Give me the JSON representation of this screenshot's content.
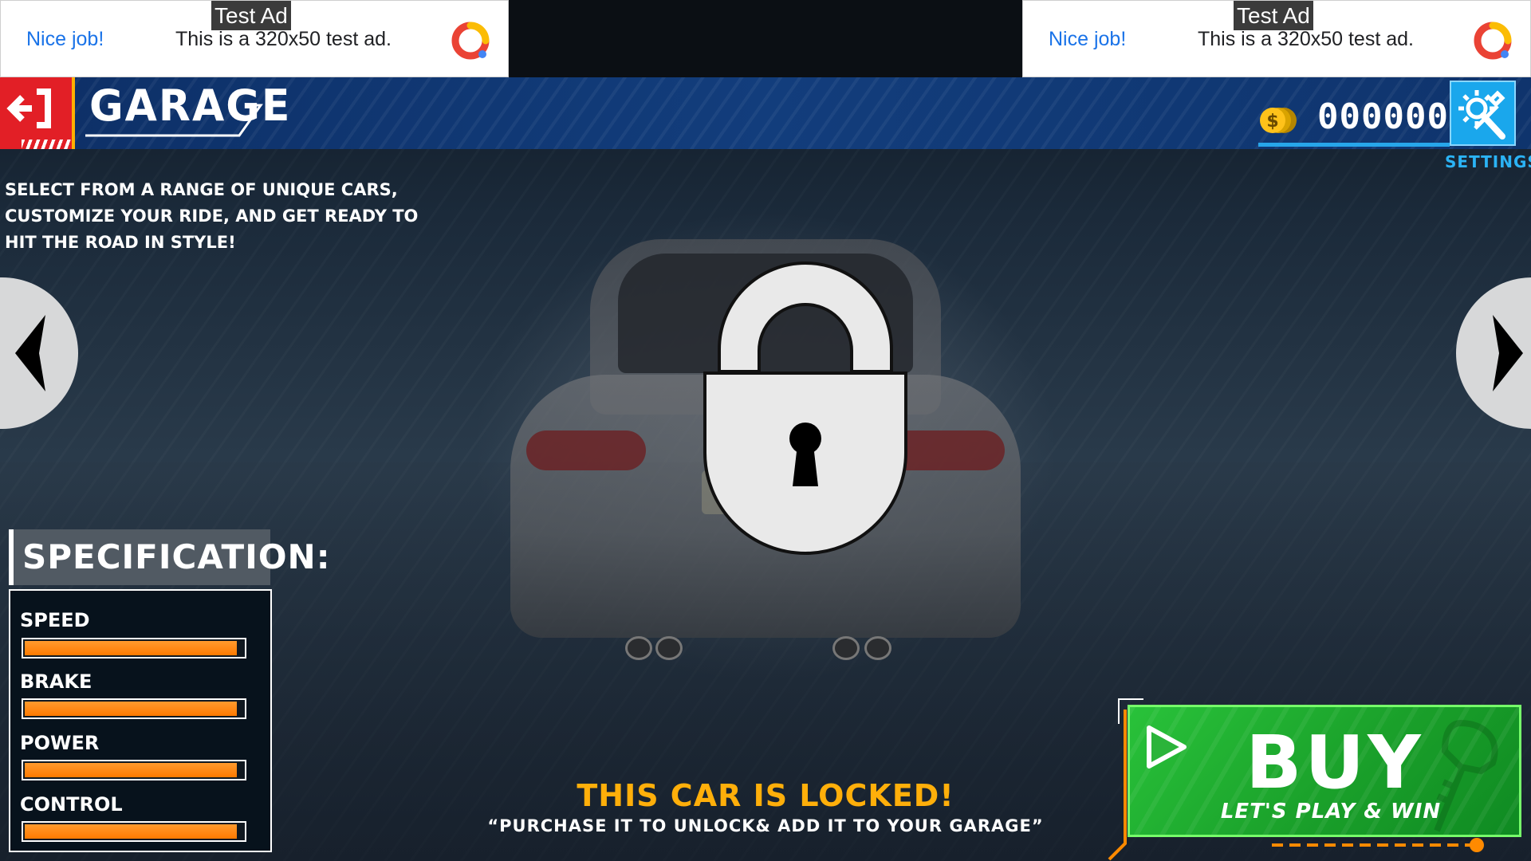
{
  "ads": [
    {
      "tag": "Test Ad",
      "headline": "Nice job!",
      "text": "This is a 320x50 test ad."
    },
    {
      "tag": "Test Ad",
      "headline": "Nice job!",
      "text": "This is a 320x50 test ad."
    }
  ],
  "header": {
    "title": "GARAGE",
    "coins": "000000",
    "settings_label": "SETTINGS",
    "exit_icon": "exit-icon",
    "settings_icon": "gear-wrench-icon",
    "coin_icon": "coin-icon"
  },
  "description": "SELECT FROM A RANGE OF UNIQUE CARS, CUSTOMIZE YOUR RIDE, AND GET READY TO HIT THE ROAD IN STYLE!",
  "navigation": {
    "prev_icon": "chevron-left-icon",
    "next_icon": "chevron-right-icon"
  },
  "lock_icon": "padlock-icon",
  "specification": {
    "title": "SPECIFICATION:",
    "stats": [
      {
        "label": "SPEED",
        "value": 0.97
      },
      {
        "label": "BRAKE",
        "value": 0.97
      },
      {
        "label": "POWER",
        "value": 0.97
      },
      {
        "label": "CONTROL",
        "value": 0.97
      }
    ]
  },
  "locked": {
    "title": "THIS CAR IS LOCKED!",
    "subtitle": "“PURCHASE IT TO UNLOCK& ADD IT TO YOUR GARAGE”"
  },
  "buy": {
    "label": "BUY",
    "sub": "LET'S PLAY & WIN",
    "play_icon": "play-icon",
    "key_icon": "car-key-icon"
  },
  "colors": {
    "header_blue": "#123d7c",
    "exit_red": "#e21f26",
    "settings_blue": "#1aa7ec",
    "stat_orange": "#ff8a00",
    "locked_yellow": "#ffaf0a",
    "buy_green": "#1aa02a"
  }
}
